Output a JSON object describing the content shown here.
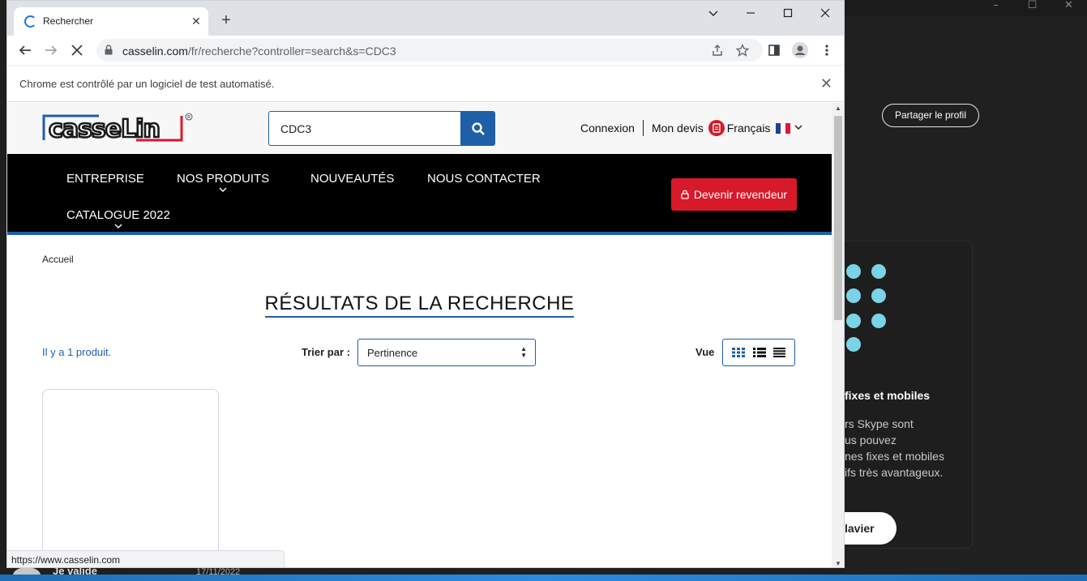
{
  "skype": {
    "share_label": "Partager le profil",
    "feature_title": "fixes et mobiles",
    "feature_desc_1": "rs Skype sont",
    "feature_desc_2": "us pouvez",
    "feature_desc_3": "nes fixes et mobiles",
    "feature_desc_4": "ifs très avantageux.",
    "clavier_label": "lavier",
    "behind_name": "Je valide",
    "behind_date": "17/11/2022",
    "dot_color": "#7ad3e6"
  },
  "browser": {
    "tab_title": "Rechercher",
    "url_host": "casselin.com",
    "url_path": "/fr/recherche?controller=search&s=CDC3",
    "infobar_text": "Chrome est contrôlé par un logiciel de test automatisé.",
    "status_url": "https://www.casselin.com"
  },
  "site": {
    "brand_color": "#1f5fa8",
    "accent_red": "#d7192a",
    "search_value": "CDC3",
    "header": {
      "connexion": "Connexion",
      "devis": "Mon devis",
      "language": "Français"
    },
    "nav": {
      "entreprise": "ENTREPRISE",
      "produits": "NOS PRODUITS",
      "nouveautes": "NOUVEAUTÉS",
      "contact": "NOUS CONTACTER",
      "catalogue": "CATALOGUE 2022",
      "revendeur": "Devenir revendeur"
    },
    "breadcrumb": "Accueil",
    "page_title": "RÉSULTATS DE LA RECHERCHE",
    "product_count": "Il y a 1 produit.",
    "sort_label": "Trier par :",
    "sort_value": "Pertinence",
    "view_label": "Vue"
  }
}
